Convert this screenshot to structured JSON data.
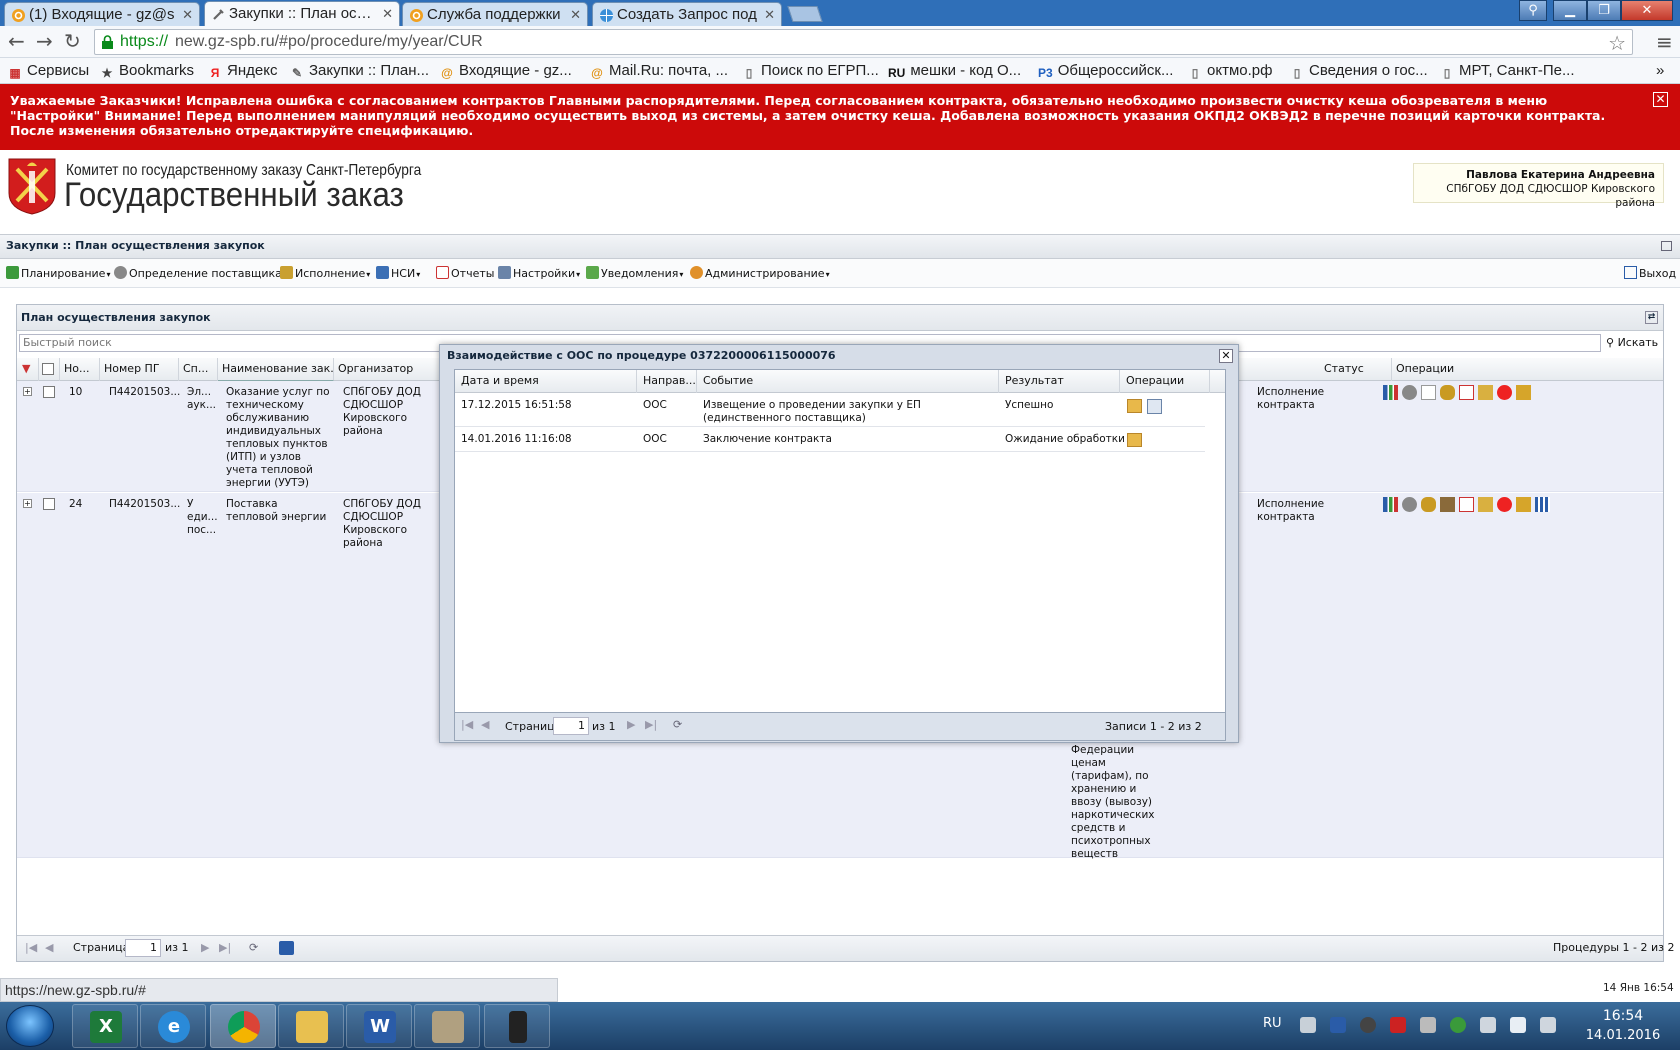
{
  "browser": {
    "tabs": [
      {
        "label": "(1) Входящие - gz@s",
        "active": false
      },
      {
        "label": "Закупки :: План осущ",
        "active": true
      },
      {
        "label": "Служба поддержки",
        "active": false
      },
      {
        "label": "Создать Запрос под",
        "active": false
      }
    ],
    "url_scheme": "https://",
    "url_rest": "new.gz-spb.ru/#po/procedure/my/year/CUR",
    "bookmarks": [
      {
        "label": "Сервисы",
        "icon": "apps-icon"
      },
      {
        "label": "Bookmarks",
        "icon": "star-icon"
      },
      {
        "label": "Яндекс",
        "icon": "yandex-icon"
      },
      {
        "label": "Закупки :: План...",
        "icon": "tools-icon"
      },
      {
        "label": "Входящие - gz...",
        "icon": "mail-at-icon"
      },
      {
        "label": "Mail.Ru: почта, ...",
        "icon": "mail-at-icon"
      },
      {
        "label": "Поиск по ЕГРП...",
        "icon": "page-icon"
      },
      {
        "label": "мешки - код О...",
        "icon": "ru-icon"
      },
      {
        "label": "Общероссийск...",
        "icon": "p3-icon"
      },
      {
        "label": "октмо.рф",
        "icon": "page-icon"
      },
      {
        "label": "Сведения о гос...",
        "icon": "page-icon"
      },
      {
        "label": "МРТ, Санкт-Пе...",
        "icon": "page-icon"
      }
    ]
  },
  "notice": {
    "text": "Уважаемые Заказчики! Исправлена ошибка с согласованием контрактов Главными распорядителями. Перед согласованием контракта, обязательно необходимо произвести очистку кеша обозревателя в меню \"Настройки\" Внимание! Перед выполнением манипуляций необходимо осуществить выход из системы, а затем очистку кеша. Добавлена возможность указания ОКПД2 ОКВЭД2 в перечне позиций карточки контракта. После изменения обязательно отредактируйте спецификацию."
  },
  "header": {
    "org_subtitle": "Комитет по государственному заказу Санкт-Петербурга",
    "org_title": "Государственный заказ",
    "user_name": "Павлова Екатерина Андреевна",
    "user_org": "СПбГОБУ ДОД СДЮСШОР Кировского района"
  },
  "app": {
    "title": "Закупки :: План осуществления закупок",
    "menu": [
      {
        "label": "Планирование",
        "icon": "planning-icon"
      },
      {
        "label": "Определение поставщика",
        "icon": "gears-icon"
      },
      {
        "label": "Исполнение",
        "icon": "execution-icon"
      },
      {
        "label": "НСИ",
        "icon": "book-icon"
      },
      {
        "label": "Отчеты",
        "icon": "report-icon"
      },
      {
        "label": "Настройки",
        "icon": "wrench-icon"
      },
      {
        "label": "Уведомления",
        "icon": "notification-icon"
      },
      {
        "label": "Администрирование",
        "icon": "user-icon"
      }
    ],
    "logout": "Выход"
  },
  "panel": {
    "title": "План осуществления закупок",
    "search_placeholder": "Быстрый поиск",
    "search_button": "Искать",
    "columns": [
      "Но...",
      "Номер ПГ",
      "Сп...",
      "Наименование зак...",
      "Организатор",
      "Статус",
      "Операции"
    ],
    "rows": [
      {
        "no": "10",
        "pg": "П44201503...",
        "method": "Эл... аук...",
        "name": "Оказание услуг по техническому обслуживанию индивидуальных тепловых пунктов (ИТП) и узлов учета тепловой энергии (УУТЭ)",
        "org": "СПбГОБУ ДОД СДЮСШОР Кировского района",
        "status": "Исполнение контракта"
      },
      {
        "no": "24",
        "pg": "П44201503...",
        "method": "У еди... пос...",
        "name": "Поставка тепловой энергии",
        "org": "СПбГОБУ ДОД СДЮСШОР Кировского района",
        "status": "Исполнение контракта",
        "hidden_text": "Федерации ценам (тарифам), по хранению и ввозу (вывозу) наркотических средств и психотропных веществ"
      }
    ],
    "pager": {
      "page_label": "Страница",
      "page": "1",
      "of": "из 1",
      "summary": "Процедуры 1 - 2 из 2"
    }
  },
  "dialog": {
    "title": "Взаимодействие с ООС по процедуре 0372200006115000076",
    "columns": [
      "Дата и время",
      "Направ...",
      "Событие",
      "Результат",
      "Операции"
    ],
    "rows": [
      {
        "datetime": "17.12.2015 16:51:58",
        "direction": "ООС",
        "event": "Извещение о проведении закупки у ЕП (единственного поставщика)",
        "result": "Успешно"
      },
      {
        "datetime": "14.01.2016 11:16:08",
        "direction": "ООС",
        "event": "Заключение контракта",
        "result": "Ожидание обработки"
      }
    ],
    "pager": {
      "page_label": "Страница",
      "page": "1",
      "of": "из 1",
      "summary": "Записи 1 - 2 из 2"
    }
  },
  "status": {
    "url": "https://new.gz-spb.ru/#",
    "date": "14 Янв 16:54"
  },
  "taskbar": {
    "lang": "RU",
    "time": "16:54",
    "date": "14.01.2016"
  }
}
